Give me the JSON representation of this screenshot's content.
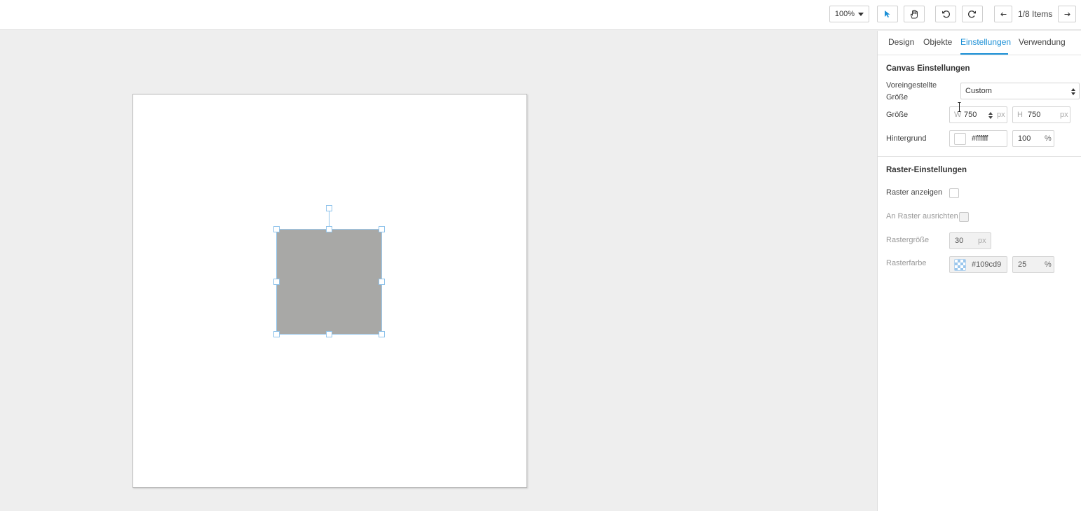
{
  "toolbar": {
    "zoom": "100%",
    "items_counter": "1/8 Items",
    "accent_color": "#1a8fd6"
  },
  "panel": {
    "tabs": [
      {
        "label": "Design"
      },
      {
        "label": "Objekte"
      },
      {
        "label": "Einstellungen",
        "active": true
      },
      {
        "label": "Verwendung"
      }
    ],
    "canvas_settings": {
      "title": "Canvas Einstellungen",
      "preset_label_line1": "Voreingestellte",
      "preset_label_line2": "Größe",
      "preset_value": "Custom",
      "size_label": "Größe",
      "width_prefix": "W",
      "width_value": "750",
      "height_prefix": "H",
      "height_value": "750",
      "unit_px": "px",
      "background_label": "Hintergrund",
      "background_color": "#ffffff",
      "background_opacity": "100",
      "percent": "%"
    },
    "grid_settings": {
      "title": "Raster-Einstellungen",
      "show_grid_label": "Raster anzeigen",
      "show_grid_checked": false,
      "snap_label": "An Raster ausrichten",
      "snap_checked": false,
      "grid_size_label": "Rastergröße",
      "grid_size_value": "30",
      "grid_color_label": "Rasterfarbe",
      "grid_color_value": "#109cd9",
      "grid_opacity": "25"
    }
  },
  "canvas": {
    "background": "#ffffff",
    "shape_fill": "#a8a8a6",
    "selection_color": "#8fc3eb"
  }
}
